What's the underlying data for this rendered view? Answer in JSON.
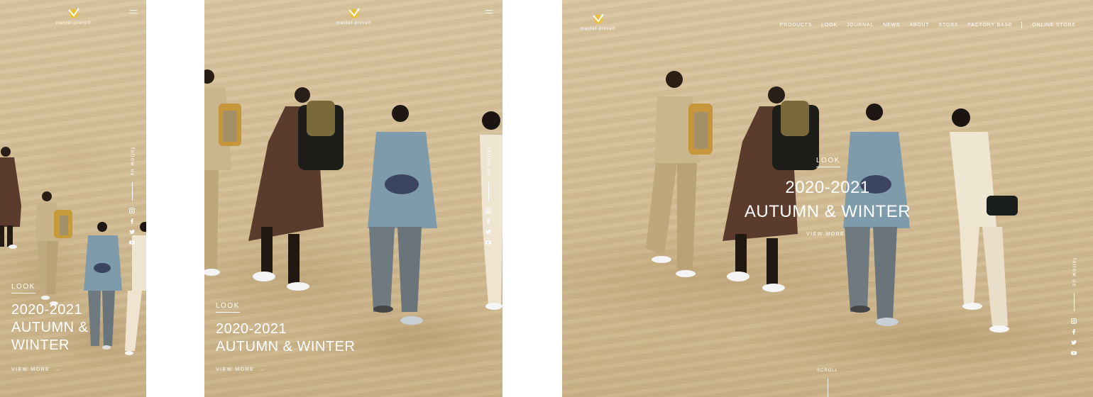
{
  "brand": {
    "logo_text": "master-piece",
    "logo_sup": "®",
    "accent": "#e8c23a"
  },
  "sidebar": {
    "follow_label": "follow us",
    "social": [
      "instagram-icon",
      "facebook-icon",
      "twitter-icon",
      "youtube-icon"
    ]
  },
  "hero": {
    "tag": "LOOK",
    "title_line1": "2020-2021",
    "title_line2": "AUTUMN &",
    "title_line3": "WINTER",
    "title_wide": "AUTUMN & WINTER",
    "view_more": "VIEW MORE",
    "view_more_arrow": "→"
  },
  "nav": {
    "items": [
      "PRODUCTS",
      "LOOK",
      "JOURNAL",
      "NEWS",
      "ABOUT",
      "STORE",
      "FACTORY BASE"
    ],
    "online_store": "ONLINE STORE"
  },
  "scroll_label": "SCROLL",
  "colors": {
    "sand": "#d5c098",
    "text": "#ffffff"
  }
}
